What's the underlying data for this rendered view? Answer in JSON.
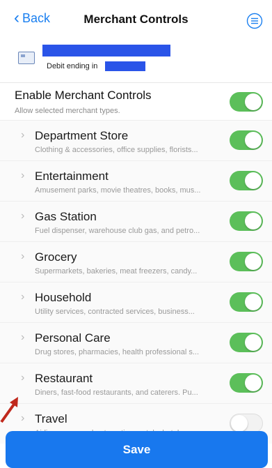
{
  "nav": {
    "back_label": "Back",
    "title": "Merchant Controls",
    "menu_icon": "menu-icon"
  },
  "card": {
    "label": "Debit ending in",
    "icon": "card-icon"
  },
  "master": {
    "label": "Enable Merchant Controls",
    "description": "Allow selected merchant types.",
    "enabled": true
  },
  "categories": [
    {
      "name": "Department Store",
      "description": "Clothing & accessories, office supplies, florists...",
      "enabled": true
    },
    {
      "name": "Entertainment",
      "description": "Amusement parks, movie theatres, books, mus...",
      "enabled": true
    },
    {
      "name": "Gas Station",
      "description": "Fuel dispenser, warehouse club gas, and petro...",
      "enabled": true
    },
    {
      "name": "Grocery",
      "description": "Supermarkets, bakeries, meat freezers, candy...",
      "enabled": true
    },
    {
      "name": "Household",
      "description": "Utility services, contracted services, business...",
      "enabled": true
    },
    {
      "name": "Personal Care",
      "description": "Drug stores, pharmacies, health professional s...",
      "enabled": true
    },
    {
      "name": "Restaurant",
      "description": "Diners, fast-food restaurants, and caterers. Pu...",
      "enabled": true
    },
    {
      "name": "Travel",
      "description": "Airlines, cars and automotive rentals, hotels, m...",
      "enabled": false
    }
  ],
  "save_label": "Save",
  "colors": {
    "accent": "#1878ee",
    "toggle_on": "#5cbf5a",
    "redaction": "#2a54e8",
    "annotation": "#c0281c"
  }
}
